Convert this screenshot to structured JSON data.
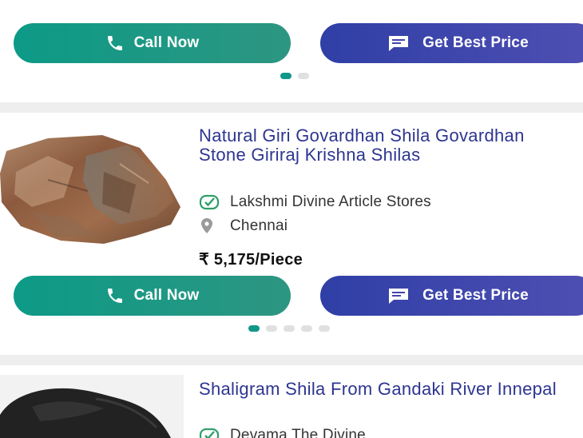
{
  "products": [
    {
      "call_label": "Call Now",
      "price_label": "Get Best Price",
      "dots": 2,
      "active_dot": 0
    },
    {
      "title": "Natural Giri Govardhan Shila Govardhan Stone Giriraj Krishna Shilas",
      "seller": "Lakshmi Divine Article Stores",
      "location": "Chennai",
      "price": "₹ 5,175/Piece",
      "call_label": "Call Now",
      "price_label": "Get Best Price",
      "dots": 5,
      "active_dot": 0
    },
    {
      "title": "Shaligram Shila From Gandaki River Innepal",
      "seller": "Devama The Divine"
    }
  ],
  "icons": {
    "call": "phone-icon",
    "price": "chat-icon",
    "seller": "verified-seller-icon",
    "location": "location-pin-icon"
  },
  "colors": {
    "call_button": "#0c9a86",
    "price_button": "#3a45aa",
    "title_text": "#2d3590",
    "active_dot": "#11978a",
    "inactive_dot": "#e0e0e0",
    "verified_icon": "#2f9e6a",
    "page_background": "#eeeeee"
  }
}
